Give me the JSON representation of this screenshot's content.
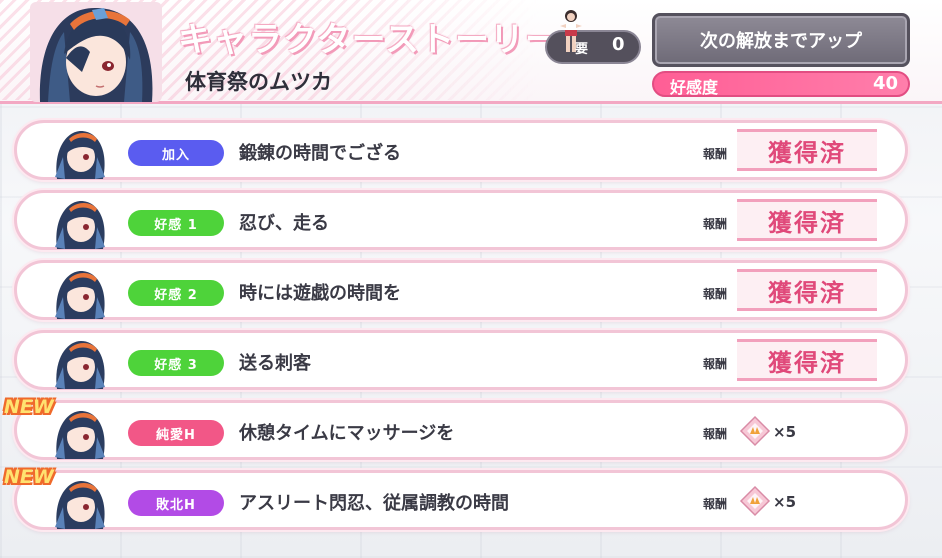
{
  "header": {
    "title": "キャラクターストーリー",
    "subtitle": "体育祭のムツカ",
    "key": {
      "label": "要",
      "count": "0"
    },
    "next_unlock_button": "次の解放までアップ",
    "affection": {
      "label": "好感度",
      "value": "40"
    }
  },
  "reward_label": "報酬",
  "stories": [
    {
      "tag": "加入",
      "tag_color": "#5a5cf0",
      "title": "鍛錬の時間でござる",
      "status": "獲得済",
      "new": false
    },
    {
      "tag": "好感 1",
      "tag_color": "#4ed33a",
      "title": "忍び、走る",
      "status": "獲得済",
      "new": false
    },
    {
      "tag": "好感 2",
      "tag_color": "#4ed33a",
      "title": "時には遊戯の時間を",
      "status": "獲得済",
      "new": false
    },
    {
      "tag": "好感 3",
      "tag_color": "#4ed33a",
      "title": "送る刺客",
      "status": "獲得済",
      "new": false
    },
    {
      "tag": "純愛H",
      "tag_color": "#f25787",
      "title": "休憩タイムにマッサージを",
      "reward_count": "×5",
      "new": true,
      "new_label": "NEW"
    },
    {
      "tag": "敗北H",
      "tag_color": "#b24be6",
      "title": "アスリート閃忍、従属調教の時間",
      "reward_count": "×5",
      "new": true,
      "new_label": "NEW"
    }
  ],
  "colors": {
    "accent_pink": "#ff5e95",
    "obtained_text": "#e0497a",
    "row_border": "#f2c5d6"
  }
}
